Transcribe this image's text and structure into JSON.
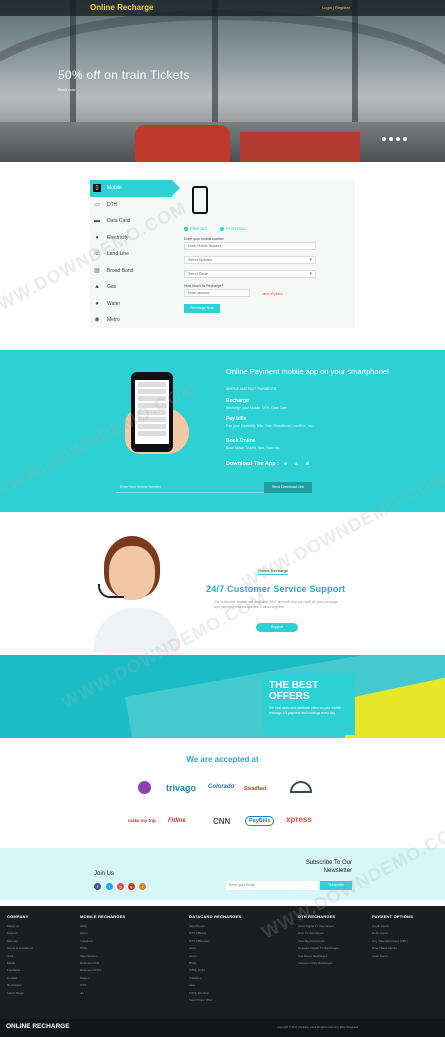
{
  "header": {
    "brand": "Online Recharge",
    "account_link": "Login | Register"
  },
  "hero": {
    "title": "50% off on train Tickets",
    "link": "Book now",
    "slides": 4
  },
  "recharge": {
    "menu": [
      {
        "label": "Mobile",
        "icon": "mobile-icon"
      },
      {
        "label": "DTH",
        "icon": "tv-icon"
      },
      {
        "label": "Data Card",
        "icon": "card-icon"
      },
      {
        "label": "Electricity",
        "icon": "bulb-icon"
      },
      {
        "label": "Land Line",
        "icon": "phone-icon"
      },
      {
        "label": "Broad Band",
        "icon": "router-icon"
      },
      {
        "label": "Gas",
        "icon": "flame-icon"
      },
      {
        "label": "Water",
        "icon": "drop-icon"
      },
      {
        "label": "Metro",
        "icon": "metro-icon"
      }
    ],
    "radio_prepaid": "PREPAID",
    "radio_postpaid": "POSTPAID",
    "number_label": "Enter your mobile number",
    "number_placeholder": "Enter Mobile Number",
    "operator_placeholder": "Select Operator",
    "circle_placeholder": "Select Circle",
    "amount_label": "How Much To Recharge?",
    "amount_placeholder": "Enter amount",
    "plans_link": "view all plans",
    "button": "Recharge Now"
  },
  "app": {
    "title": "Online Payment mobile app on your smartphone!",
    "subtitle": "SIMPLE AND FAST PAYMENTS",
    "features": [
      {
        "heading": "Recharge",
        "text": "Recharge your Mobile, DTH, Data Card"
      },
      {
        "heading": "Pay bills",
        "text": "Pay your Electricity Bills, Gas, Broadband, Landline, etc."
      },
      {
        "heading": "Book Online",
        "text": "Book Movie Tickets, Bus, Train etc."
      }
    ],
    "download": "Download The App :",
    "number_placeholder": "Enter Your Mobile Number",
    "send_button": "Send Download Link"
  },
  "support": {
    "tag": "Online Recharge",
    "title": "24/7 Customer Service Support",
    "text": "Our customer service are available 24x7 and will help you with all your recharge and payment related queries. Call us anytime.",
    "button": "Support"
  },
  "offers": {
    "title": "THE BEST OFFERS",
    "text": "Get best deals and cashback offers on your mobile recharge, bill payment and bookings every day."
  },
  "accepted": {
    "title": "We are accepted at",
    "logos": [
      {
        "name": "",
        "color": "#8e44ad"
      },
      {
        "name": "trivago",
        "color": "#2a7fbf"
      },
      {
        "name": "Colorado",
        "color": "#2e6fb5"
      },
      {
        "name": "Steadfast",
        "color": "#c0392b"
      },
      {
        "name": "",
        "color": "#34495e"
      },
      {
        "name": "make my trip",
        "color": "#c0392b"
      },
      {
        "name": "Fitline",
        "color": "#c0392b"
      },
      {
        "name": "CNN",
        "color": "#555555"
      },
      {
        "name": "PayBills",
        "color": "#2a7fbf"
      },
      {
        "name": "xpress",
        "color": "#e74c3c"
      }
    ]
  },
  "newsletter": {
    "join": "Join Us",
    "title": "Subscribe To Our Newsletter",
    "email_placeholder": "Enter your Email",
    "button": "Subscribe"
  },
  "footer": {
    "columns": [
      {
        "title": "COMPANY",
        "links": [
          "About Us",
          "Support",
          "Sitemap",
          "Terms & Conditions",
          "Jobs",
          "Media",
          "Feedback",
          "Contact",
          "Recharges",
          "Latest Blogs"
        ]
      },
      {
        "title": "MOBILE RECHARGES",
        "links": [
          "Airtel",
          "Aircel",
          "Vodafone",
          "BSNL",
          "Tata Docomo",
          "Reliance GSM",
          "Reliance CDMA",
          "Telenor",
          "MTS",
          "Jio"
        ]
      },
      {
        "title": "DATACARD RECHARGES",
        "links": [
          "Tata Photon",
          "MTS MBlaze",
          "MTS MBrowse",
          "Airtel",
          "Aircel",
          "BSNL",
          "MTNL Delhi",
          "Vodafone",
          "Idea",
          "MTNL Mumbai",
          "Tata Photon Whiz"
        ]
      },
      {
        "title": "DTH RECHARGES",
        "links": [
          "Airtel Digital TV Recharges",
          "Dish TV Recharges",
          "Tata Sky Recharges",
          "Reliance Digital TV Recharges",
          "Sun Direct Recharges",
          "Videocon D2H Recharges"
        ]
      },
      {
        "title": "PAYMENT OPTIONS",
        "links": [
          "Credit Cards",
          "Debit Cards",
          "Any Visa Debit Card (VBV)",
          "Direct Bank Debits",
          "Cash Cards"
        ]
      }
    ],
    "bottom_brand": "ONLINE RECHARGE",
    "copyright": "Copyright © 2017 Company name All rights reserved | More Templates"
  },
  "watermark": "WWW.DOWNDEMO.COM",
  "colors": {
    "accent": "#2dd1d3",
    "brand_yellow": "#f2d33a",
    "footer_bg": "#1c1d1f"
  }
}
